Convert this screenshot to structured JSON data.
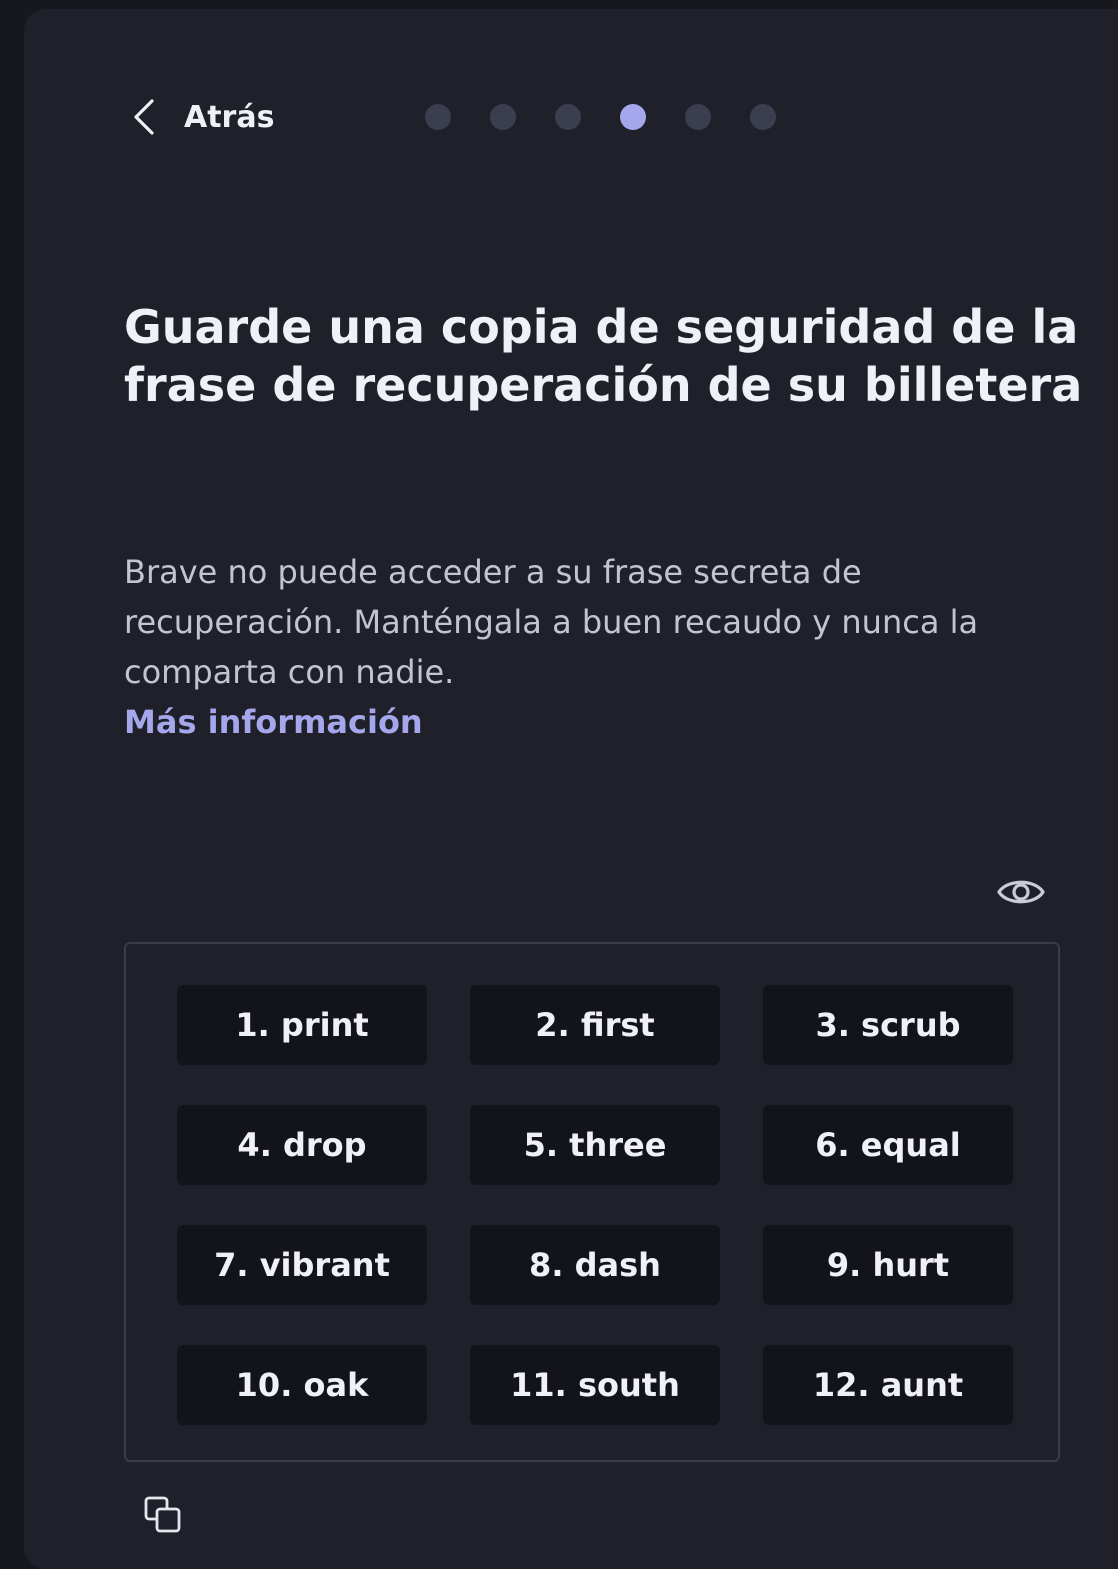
{
  "header": {
    "back_label": "Atrás",
    "steps_total": 6,
    "steps_active_index": 3
  },
  "main": {
    "title": "Guarde una copia de seguridad de la frase de recuperación de su billetera",
    "description": "Brave no puede acceder a su frase secreta de recuperación. Manténgala a buen recaudo y nunca la comparta con nadie.",
    "learn_more_label": "Más información"
  },
  "phrase": {
    "words": [
      "1. print",
      "2. first",
      "3. scrub",
      "4. drop",
      "5. three",
      "6. equal",
      "7. vibrant",
      "8. dash",
      "9. hurt",
      "10. oak",
      "11. south",
      "12. aunt"
    ]
  },
  "icons": {
    "back": "chevron-left-icon",
    "reveal": "eye-icon",
    "copy": "copy-icon"
  },
  "colors": {
    "accent": "#a4a7ec",
    "background": "#1f2029",
    "word_chip": "#13141a",
    "inactive_dot": "#3b3e4f"
  }
}
